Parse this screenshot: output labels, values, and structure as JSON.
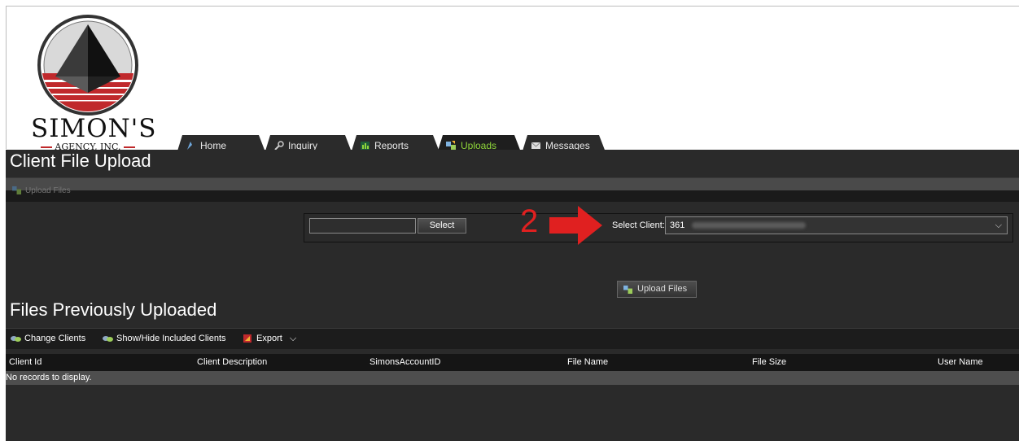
{
  "logo": {
    "line1": "SIMON'S",
    "line2": "AGENCY, INC."
  },
  "tabs": [
    {
      "label": "Home",
      "icon": "home-icon"
    },
    {
      "label": "Inquiry",
      "icon": "search-icon"
    },
    {
      "label": "Reports",
      "icon": "reports-icon"
    },
    {
      "label": "Uploads",
      "icon": "uploads-icon",
      "active": true
    },
    {
      "label": "Messages",
      "icon": "messages-icon"
    }
  ],
  "upload_section": {
    "title": "Client File Upload",
    "toolbar_label": "Upload Files",
    "client_search_value": "",
    "select_button": "Select",
    "annotation_number": "2",
    "select_client_label": "Select Client:",
    "selected_client": "361",
    "upload_button": "Upload Files"
  },
  "files_section": {
    "title": "Files Previously Uploaded",
    "toolbar": {
      "change_clients": "Change Clients",
      "show_hide": "Show/Hide Included Clients",
      "export": "Export"
    },
    "columns": [
      "Client Id",
      "Client Description",
      "SimonsAccountID",
      "File Name",
      "File Size",
      "User Name"
    ],
    "empty_message": "No records to display."
  },
  "colors": {
    "accent_green": "#8fd63a",
    "annotation_red": "#e02020",
    "logo_red": "#c0292c"
  }
}
